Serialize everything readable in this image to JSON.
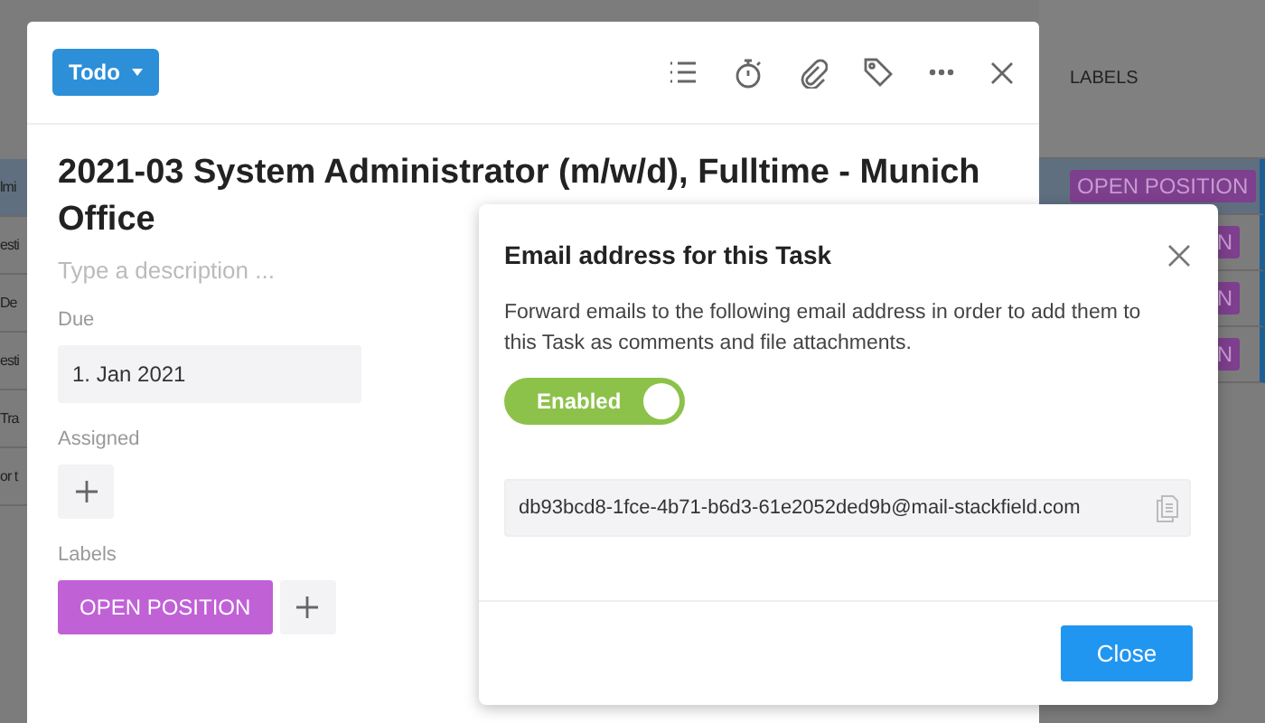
{
  "background_table": {
    "row_fragments": [
      "lmi",
      "esti",
      "De",
      "esti",
      "Tra",
      "or t"
    ],
    "column_header": "LABELS",
    "label_badges": [
      {
        "text": "OPEN POSITION"
      },
      {
        "text": "N"
      },
      {
        "text": "N"
      },
      {
        "text": "N"
      }
    ]
  },
  "task": {
    "status_button": "Todo",
    "title": "2021-03 System Administrator (m/w/d), Fulltime - Munich Office",
    "description_placeholder": "Type a description ...",
    "fields": [
      {
        "kind": "date",
        "label": "Due",
        "value": "1. Jan 2021"
      },
      {
        "kind": "assignees",
        "label": "Assigned"
      },
      {
        "kind": "labels",
        "label": "Labels",
        "labels": [
          {
            "text": "OPEN POSITION",
            "color": "#c061d6"
          }
        ]
      }
    ]
  },
  "email_dialog": {
    "title": "Email address for this Task",
    "description": "Forward emails to the following email address in order to add them to this Task as comments and file attachments.",
    "toggle": {
      "label": "Enabled",
      "on": true
    },
    "address": "db93bcd8-1fce-4b71-b6d3-61e2052ded9b@mail-stackfield.com",
    "close_button": "Close"
  }
}
